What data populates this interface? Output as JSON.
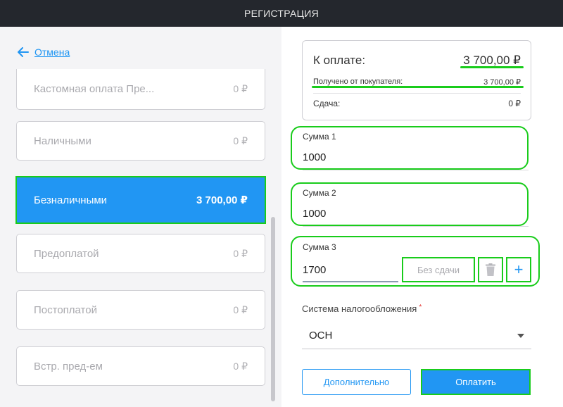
{
  "header": {
    "title": "РЕГИСТРАЦИЯ"
  },
  "left": {
    "back_label": "Отмена",
    "payment_methods": [
      {
        "label": "Кастомная оплата Пре...",
        "amount": "0 ₽"
      },
      {
        "label": "Наличными",
        "amount": "0 ₽"
      },
      {
        "label": "Безналичными",
        "amount": "3 700,00 ₽"
      },
      {
        "label": "Предоплатой",
        "amount": "0 ₽"
      },
      {
        "label": "Постоплатой",
        "amount": "0 ₽"
      },
      {
        "label": "Встр. пред-ем",
        "amount": "0 ₽"
      }
    ]
  },
  "summary": {
    "to_pay_label": "К оплате:",
    "to_pay_value": "3 700,00 ₽",
    "received_label": "Получено от покупателя:",
    "received_value": "3 700,00 ₽",
    "change_label": "Сдача:",
    "change_value": "0 ₽"
  },
  "sums": [
    {
      "label": "Сумма 1",
      "value": "1000"
    },
    {
      "label": "Сумма 2",
      "value": "1000"
    },
    {
      "label": "Сумма 3",
      "value": "1700"
    }
  ],
  "sum3_actions": {
    "no_change_label": "Без сдачи",
    "plus_symbol": "+"
  },
  "tax": {
    "label": "Система налогообложения",
    "required_mark": "*",
    "value": "ОСН"
  },
  "buttons": {
    "extra_label": "Дополнительно",
    "pay_label": "Оплатить"
  },
  "colors": {
    "accent": "#2196f3",
    "highlight": "#19cc1b",
    "header_bg": "#24272d",
    "required": "#e53935"
  }
}
